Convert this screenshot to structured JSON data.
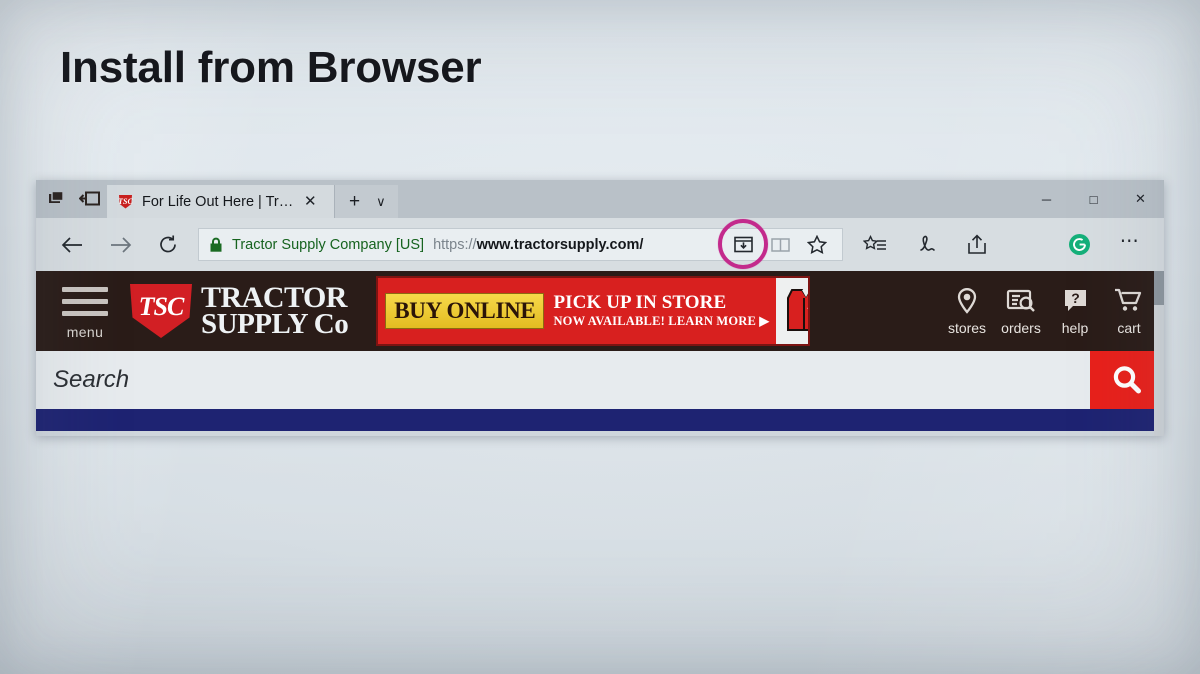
{
  "slide": {
    "title": "Install from Browser"
  },
  "browser": {
    "tabs_aside_icon": "set-tabs-aside-icon",
    "tabs_aside_list_icon": "tabs-you-set-aside-icon",
    "tab": {
      "favicon": "tsc-shield-favicon",
      "title": "For Life Out Here | Tract",
      "close_label": "✕"
    },
    "new_tab_label": "+",
    "tab_menu_chevron": "∨",
    "window_controls": {
      "minimize": "─",
      "maximize": "□",
      "close": "✕"
    },
    "nav": {
      "back": "←",
      "forward": "→",
      "refresh": "↻"
    },
    "address": {
      "lock_icon": "lock-icon",
      "site_identity": "Tractor Supply Company [US]",
      "url_scheme": "https://",
      "url_host": "www.tractorsupply.com/",
      "install_app_icon": "install-app-icon",
      "reading_view_icon": "reading-view-icon",
      "favorites_icon": "favorite-star-icon",
      "highlight_color": "#c32a8c"
    },
    "toolbar": {
      "favorites_list_icon": "favorites-list-icon",
      "web_note_icon": "web-note-pen-icon",
      "share_icon": "share-icon",
      "extension_icon": "grammarly-extension-icon",
      "extension_color": "#15b07a",
      "more_label": "⋯"
    }
  },
  "site": {
    "header_color": "#2a1c18",
    "menu_label": "menu",
    "logo": {
      "shield_text": "TSC",
      "line1": "TRACTOR",
      "line2": "SUPPLY Co",
      "registered_mark": "®",
      "shield_color": "#d21f24"
    },
    "banner": {
      "buy_online": "BUY ONLINE",
      "headline": "PICK UP IN STORE",
      "subline": "NOW AVAILABLE!  LEARN MORE ▶",
      "art": "red-vest-with-cursor-icon",
      "bg_color": "#d8201f"
    },
    "nav_items": [
      {
        "label": "stores",
        "icon": "map-pin-icon"
      },
      {
        "label": "orders",
        "icon": "order-lookup-icon"
      },
      {
        "label": "help",
        "icon": "help-question-bubble-icon"
      },
      {
        "label": "cart",
        "icon": "shopping-cart-icon"
      }
    ],
    "search": {
      "placeholder": "Search",
      "value": "",
      "button_icon": "search-magnifier-icon",
      "button_color": "#e8201b"
    },
    "promo_bar": {
      "text": "",
      "color": "#1e2372"
    }
  }
}
